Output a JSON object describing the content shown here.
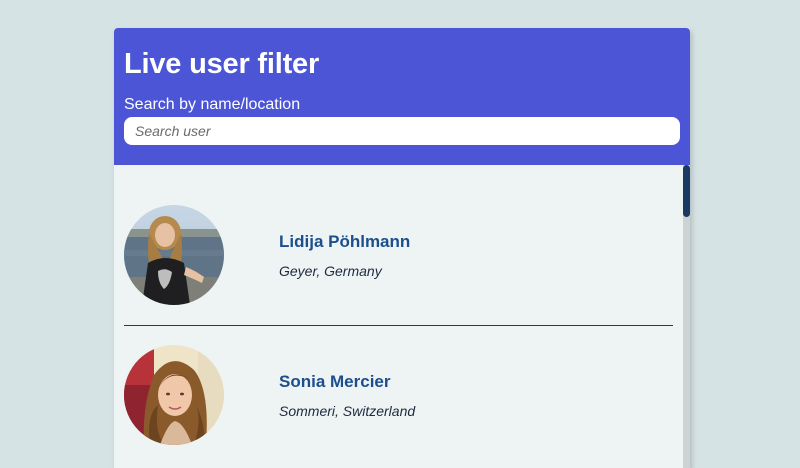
{
  "header": {
    "title": "Live user filter",
    "subtitle": "Search by name/location"
  },
  "search": {
    "placeholder": "Search user",
    "value": ""
  },
  "users": [
    {
      "name": "Lidija Pöhlmann",
      "location": "Geyer, Germany",
      "avatar_icon": "profile-photo-woman-blonde-lake"
    },
    {
      "name": "Sonia Mercier",
      "location": "Sommeri, Switzerland",
      "avatar_icon": "profile-photo-woman-curly-hair"
    }
  ],
  "colors": {
    "page_background": "#d6e3e5",
    "header_background": "#4b55d5",
    "list_background": "#eef3f3",
    "name_color": "#1c4f8c",
    "divider": "#1b3a73",
    "scrollbar_thumb": "#1b3a63"
  }
}
